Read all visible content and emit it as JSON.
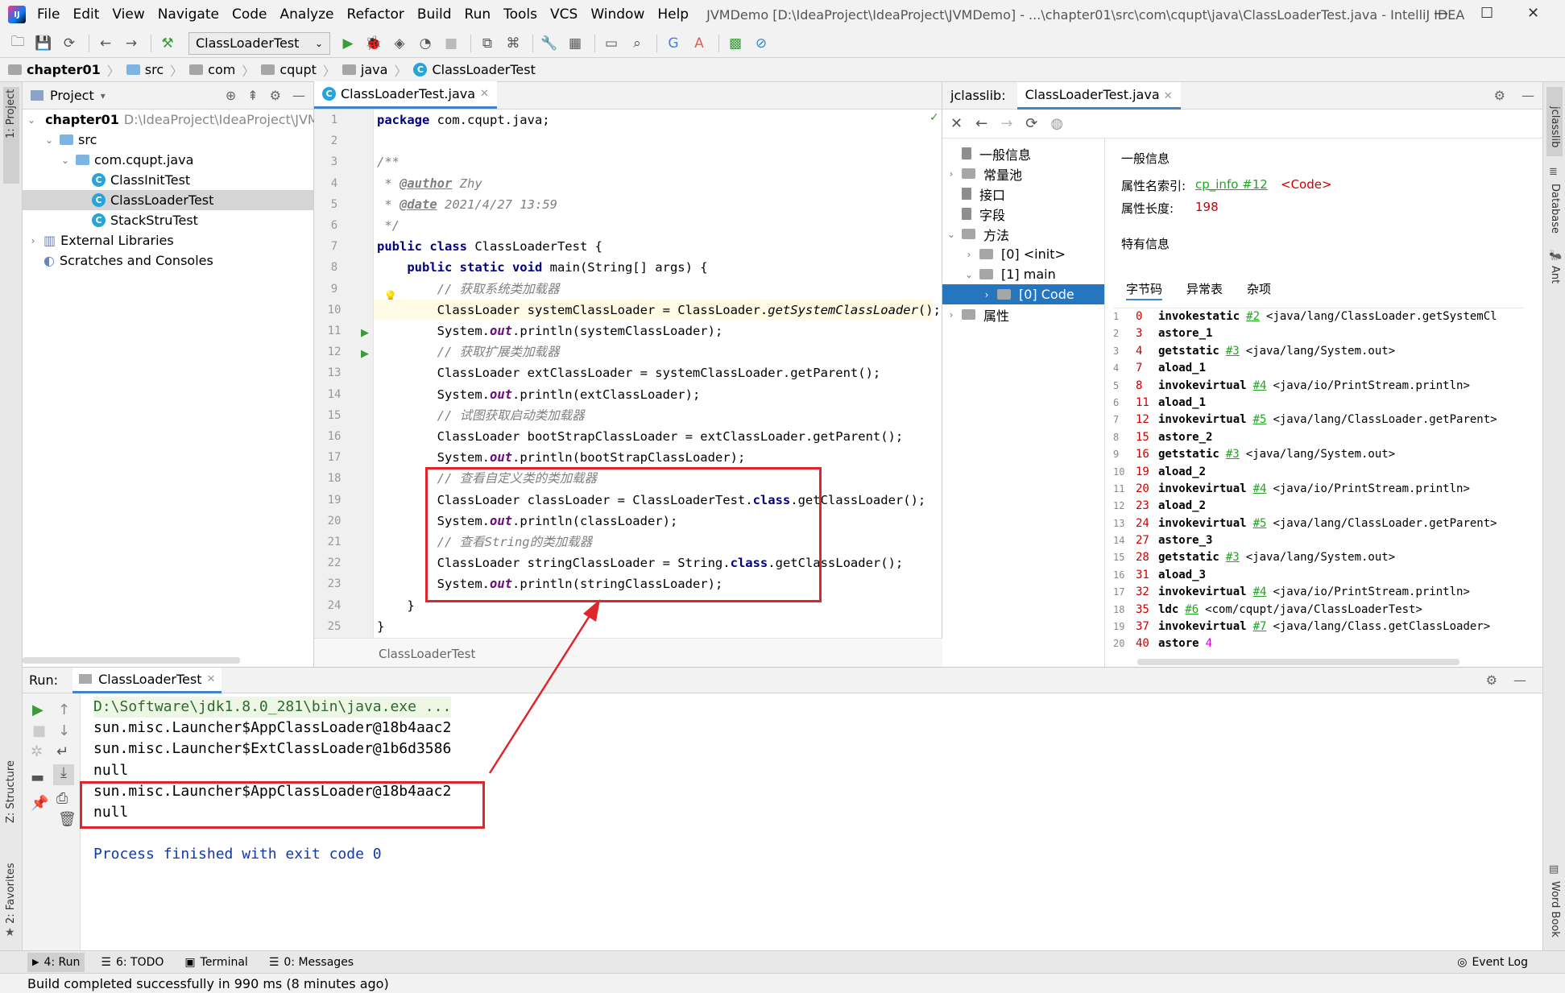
{
  "app": {
    "menu": [
      "File",
      "Edit",
      "View",
      "Navigate",
      "Code",
      "Analyze",
      "Refactor",
      "Build",
      "Run",
      "Tools",
      "VCS",
      "Window",
      "Help"
    ],
    "window_title": "JVMDemo [D:\\IdeaProject\\IdeaProject\\JVMDemo] - ...\\chapter01\\src\\com\\cqupt\\java\\ClassLoaderTest.java - IntelliJ IDEA",
    "logo_text": "IJ"
  },
  "toolbar": {
    "run_config": "ClassLoaderTest"
  },
  "breadcrumb": [
    "chapter01",
    "src",
    "com",
    "cqupt",
    "java",
    "ClassLoaderTest"
  ],
  "side_tools": {
    "left_top": "1: Project",
    "left_structure": "Z: Structure",
    "left_favorites": "2: Favorites",
    "right_top": "jclasslib",
    "right_db": "Database",
    "right_ant": "Ant",
    "right_wordbook": "Word Book"
  },
  "project": {
    "header": "Project",
    "tree": [
      {
        "label": "chapter01",
        "extra": "D:\\IdeaProject\\IdeaProject\\JVM",
        "indent": 0,
        "arrow": "⌄",
        "icon": "folder-gray",
        "bold": true
      },
      {
        "label": "src",
        "extra": "",
        "indent": 1,
        "arrow": "⌄",
        "icon": "folder"
      },
      {
        "label": "com.cqupt.java",
        "extra": "",
        "indent": 2,
        "arrow": "⌄",
        "icon": "folder"
      },
      {
        "label": "ClassInitTest",
        "extra": "",
        "indent": 3,
        "arrow": "",
        "icon": "class"
      },
      {
        "label": "ClassLoaderTest",
        "extra": "",
        "indent": 3,
        "arrow": "",
        "icon": "class",
        "selected": true
      },
      {
        "label": "StackStruTest",
        "extra": "",
        "indent": 3,
        "arrow": "",
        "icon": "class"
      },
      {
        "label": "External Libraries",
        "extra": "",
        "indent": 0,
        "arrow": "›",
        "icon": "lib"
      },
      {
        "label": "Scratches and Consoles",
        "extra": "",
        "indent": 0,
        "arrow": "",
        "icon": "scratch"
      }
    ]
  },
  "editor": {
    "tab": "ClassLoaderTest.java",
    "footer": "ClassLoaderTest",
    "line_numbers": [
      "1",
      "2",
      "3",
      "4",
      "5",
      "6",
      "7",
      "8",
      "9",
      "10",
      "11",
      "12",
      "13",
      "14",
      "15",
      "16",
      "17",
      "18",
      "19",
      "20",
      "21",
      "22",
      "23",
      "24",
      "25"
    ]
  },
  "jclasslib": {
    "label": "jclasslib:",
    "tab": "ClassLoaderTest.java",
    "tree": [
      {
        "label": "一般信息",
        "indent": 0,
        "arrow": ""
      },
      {
        "label": "常量池",
        "indent": 0,
        "arrow": "›"
      },
      {
        "label": "接口",
        "indent": 0,
        "arrow": ""
      },
      {
        "label": "字段",
        "indent": 0,
        "arrow": ""
      },
      {
        "label": "方法",
        "indent": 0,
        "arrow": "⌄"
      },
      {
        "label": "[0] <init>",
        "indent": 1,
        "arrow": "›"
      },
      {
        "label": "[1] main",
        "indent": 1,
        "arrow": "⌄"
      },
      {
        "label": "[0] Code",
        "indent": 2,
        "arrow": "›",
        "selected": true
      },
      {
        "label": "属性",
        "indent": 0,
        "arrow": "›"
      }
    ],
    "general_title": "一般信息",
    "name_index_label": "属性名索引:",
    "name_index_ref": "cp_info #12",
    "name_index_value": "<Code>",
    "length_label": "属性长度:",
    "length_value": "198",
    "specific_title": "特有信息",
    "tabs": [
      "字节码",
      "异常表",
      "杂项"
    ],
    "bytecode": [
      {
        "n": "1",
        "off": "0",
        "ins": "invokestatic",
        "ref": "#2",
        "arg": "<java/lang/ClassLoader.getSystemCl"
      },
      {
        "n": "2",
        "off": "3",
        "ins": "astore_1",
        "ref": "",
        "arg": ""
      },
      {
        "n": "3",
        "off": "4",
        "ins": "getstatic",
        "ref": "#3",
        "arg": "<java/lang/System.out>"
      },
      {
        "n": "4",
        "off": "7",
        "ins": "aload_1",
        "ref": "",
        "arg": ""
      },
      {
        "n": "5",
        "off": "8",
        "ins": "invokevirtual",
        "ref": "#4",
        "arg": "<java/io/PrintStream.println>"
      },
      {
        "n": "6",
        "off": "11",
        "ins": "aload_1",
        "ref": "",
        "arg": ""
      },
      {
        "n": "7",
        "off": "12",
        "ins": "invokevirtual",
        "ref": "#5",
        "arg": "<java/lang/ClassLoader.getParent>"
      },
      {
        "n": "8",
        "off": "15",
        "ins": "astore_2",
        "ref": "",
        "arg": ""
      },
      {
        "n": "9",
        "off": "16",
        "ins": "getstatic",
        "ref": "#3",
        "arg": "<java/lang/System.out>"
      },
      {
        "n": "10",
        "off": "19",
        "ins": "aload_2",
        "ref": "",
        "arg": ""
      },
      {
        "n": "11",
        "off": "20",
        "ins": "invokevirtual",
        "ref": "#4",
        "arg": "<java/io/PrintStream.println>"
      },
      {
        "n": "12",
        "off": "23",
        "ins": "aload_2",
        "ref": "",
        "arg": ""
      },
      {
        "n": "13",
        "off": "24",
        "ins": "invokevirtual",
        "ref": "#5",
        "arg": "<java/lang/ClassLoader.getParent>"
      },
      {
        "n": "14",
        "off": "27",
        "ins": "astore_3",
        "ref": "",
        "arg": ""
      },
      {
        "n": "15",
        "off": "28",
        "ins": "getstatic",
        "ref": "#3",
        "arg": "<java/lang/System.out>"
      },
      {
        "n": "16",
        "off": "31",
        "ins": "aload_3",
        "ref": "",
        "arg": ""
      },
      {
        "n": "17",
        "off": "32",
        "ins": "invokevirtual",
        "ref": "#4",
        "arg": "<java/io/PrintStream.println>"
      },
      {
        "n": "18",
        "off": "35",
        "ins": "ldc",
        "ref": "#6",
        "arg": "<com/cqupt/java/ClassLoaderTest>"
      },
      {
        "n": "19",
        "off": "37",
        "ins": "invokevirtual",
        "ref": "#7",
        "arg": "<java/lang/Class.getClassLoader>"
      },
      {
        "n": "20",
        "off": "40",
        "ins": "astore",
        "ref": "",
        "arg": "4"
      }
    ]
  },
  "run": {
    "label": "Run:",
    "tab": "ClassLoaderTest",
    "console": [
      "D:\\Software\\jdk1.8.0_281\\bin\\java.exe ...",
      "sun.misc.Launcher$AppClassLoader@18b4aac2",
      "sun.misc.Launcher$ExtClassLoader@1b6d3586",
      "null",
      "sun.misc.Launcher$AppClassLoader@18b4aac2",
      "null",
      "",
      "Process finished with exit code 0"
    ]
  },
  "bottom_tabs": [
    "4: Run",
    "6: TODO",
    "Terminal",
    "0: Messages"
  ],
  "event_log": "Event Log",
  "status": "Build completed successfully in 990 ms (8 minutes ago)",
  "colors": {
    "accent": "#4083c9",
    "highlight_box": "#e0262b",
    "keyword": "#000080",
    "comment": "#808080"
  }
}
